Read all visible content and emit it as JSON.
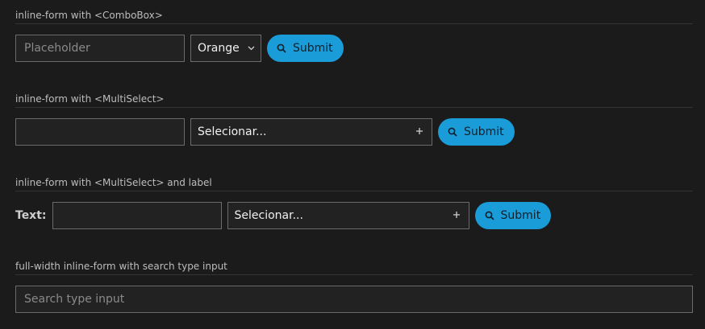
{
  "sections": [
    {
      "title": "inline-form with <ComboBox>",
      "input_placeholder": "Placeholder",
      "combo_value": "Orange",
      "submit_label": "Submit"
    },
    {
      "title": "inline-form with <MultiSelect>",
      "input_value": "",
      "multiselect_placeholder": "Selecionar...",
      "submit_label": "Submit"
    },
    {
      "title": "inline-form with <MultiSelect> and label",
      "label": "Text:",
      "input_value": "",
      "multiselect_placeholder": "Selecionar...",
      "submit_label": "Submit"
    },
    {
      "title": "full-width inline-form with search type input",
      "search_placeholder": "Search type input"
    }
  ],
  "colors": {
    "background": "#1b1b1b",
    "accent": "#1a9cd8",
    "border": "#6b6b6b"
  },
  "icons": {
    "submit": "search-icon",
    "combo": "chevron-down-icon",
    "multiselect": "plus-icon"
  }
}
